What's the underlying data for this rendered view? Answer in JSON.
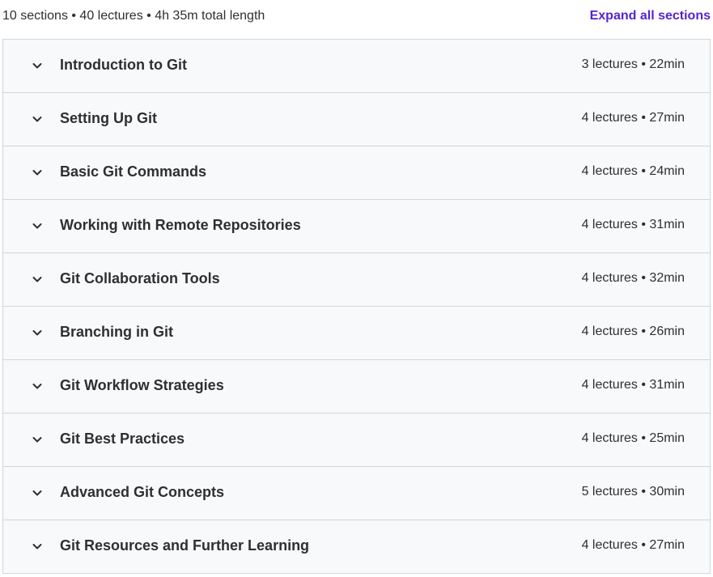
{
  "curriculum": {
    "summary": "10 sections • 40 lectures • 4h 35m total length",
    "expand_label": "Expand all sections",
    "sections": [
      {
        "title": "Introduction to Git",
        "meta": "3 lectures • 22min"
      },
      {
        "title": "Setting Up Git",
        "meta": "4 lectures • 27min"
      },
      {
        "title": "Basic Git Commands",
        "meta": "4 lectures • 24min"
      },
      {
        "title": "Working with Remote Repositories",
        "meta": "4 lectures • 31min"
      },
      {
        "title": "Git Collaboration Tools",
        "meta": "4 lectures • 32min"
      },
      {
        "title": "Branching in Git",
        "meta": "4 lectures • 26min"
      },
      {
        "title": "Git Workflow Strategies",
        "meta": "4 lectures • 31min"
      },
      {
        "title": "Git Best Practices",
        "meta": "4 lectures • 25min"
      },
      {
        "title": "Advanced Git Concepts",
        "meta": "5 lectures • 30min"
      },
      {
        "title": "Git Resources and Further Learning",
        "meta": "4 lectures • 27min"
      }
    ]
  },
  "icons": {
    "section_toggle": "chevron-down-icon"
  },
  "colors": {
    "accent": "#5624d0",
    "text": "#2d2f31",
    "row_bg": "#f7f9fa",
    "border": "#d1d7dc"
  }
}
